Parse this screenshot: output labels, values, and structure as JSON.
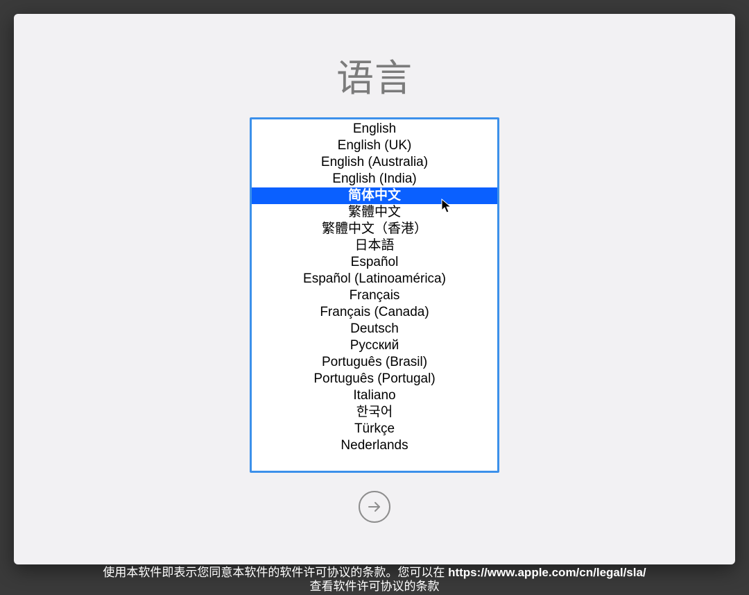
{
  "title": "语言",
  "languages": [
    "English",
    "English (UK)",
    "English (Australia)",
    "English (India)",
    "简体中文",
    "繁體中文",
    "繁體中文（香港）",
    "日本語",
    "Español",
    "Español (Latinoamérica)",
    "Français",
    "Français (Canada)",
    "Deutsch",
    "Русский",
    "Português (Brasil)",
    "Português (Portugal)",
    "Italiano",
    "한국어",
    "Türkçe",
    "Nederlands"
  ],
  "selected_index": 4,
  "footer": {
    "line1_prefix": "使用本软件即表示您同意本软件的软件许可协议的条款。您可以在 ",
    "url": "https://www.apple.com/cn/legal/sla/",
    "line2": "查看软件许可协议的条款"
  }
}
